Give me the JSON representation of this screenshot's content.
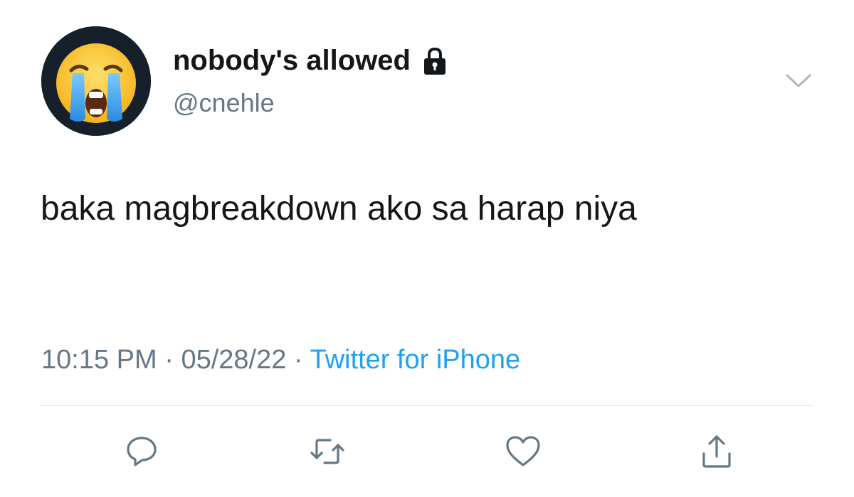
{
  "user": {
    "display_name": "nobody's allowed",
    "handle": "@cnehle",
    "avatar_icon": "loudly-crying-face-emoji",
    "protected_icon": "lock-icon"
  },
  "tweet": {
    "text": "baka magbreakdown ako sa harap niya",
    "time": "10:15 PM",
    "date": "05/28/22",
    "separator": "·",
    "source": "Twitter for iPhone"
  },
  "actions": {
    "reply_icon": "reply-icon",
    "retweet_icon": "retweet-icon",
    "like_icon": "heart-icon",
    "share_icon": "share-icon",
    "more_icon": "chevron-down-icon"
  },
  "colors": {
    "text": "#14171a",
    "muted": "#657786",
    "link": "#1da1f2",
    "divider": "#e1e8ed"
  }
}
